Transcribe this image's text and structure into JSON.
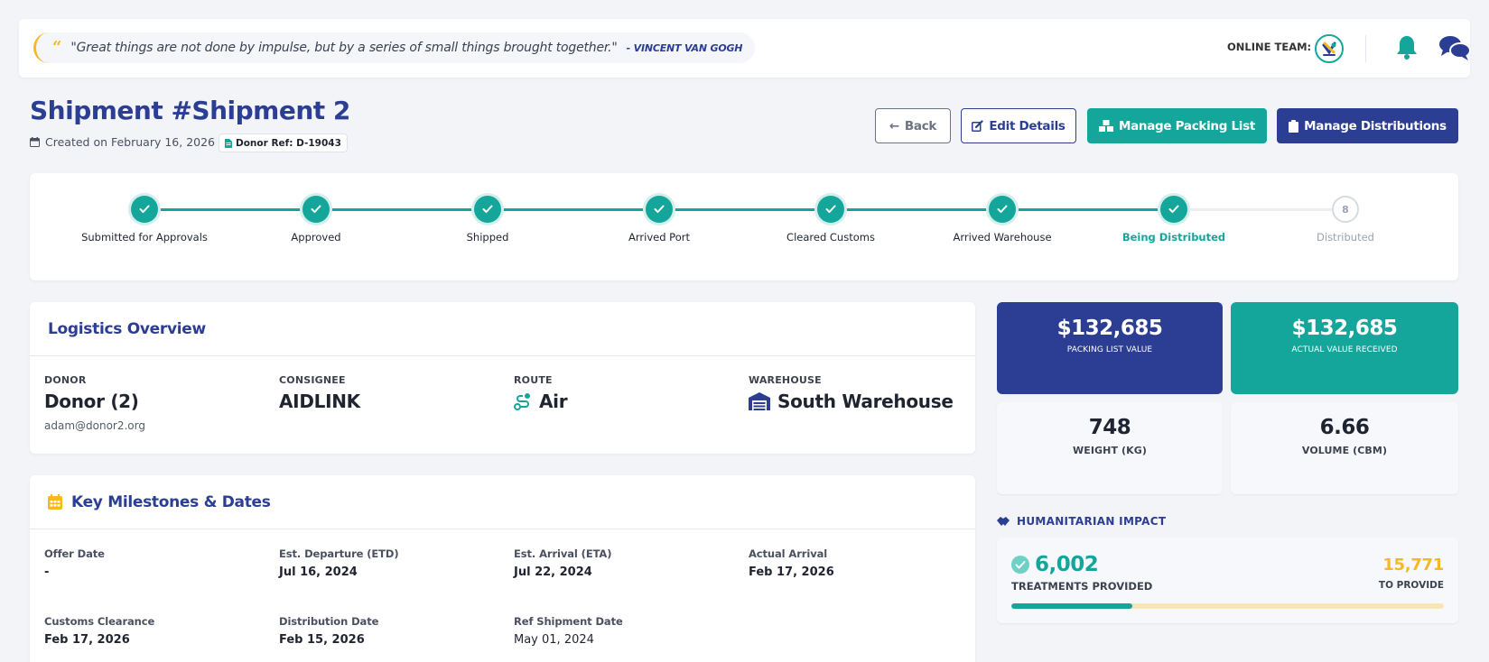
{
  "topbar": {
    "quote": "\"Great things are not done by impulse, but by a series of small things brought together.\"",
    "quote_author": "- VINCENT VAN GOGH",
    "online_label": "ONLINE TEAM:"
  },
  "header": {
    "title": "Shipment #Shipment 2",
    "created": "Created on February 16, 2026",
    "donor_ref": "Donor Ref: D-19043"
  },
  "actions": {
    "back": "Back",
    "edit": "Edit Details",
    "packing": "Manage Packing List",
    "distributions": "Manage Distributions"
  },
  "steps": [
    {
      "label": "Submitted for Approvals",
      "state": "done"
    },
    {
      "label": "Approved",
      "state": "done"
    },
    {
      "label": "Shipped",
      "state": "done"
    },
    {
      "label": "Arrived Port",
      "state": "done"
    },
    {
      "label": "Cleared Customs",
      "state": "done"
    },
    {
      "label": "Arrived Warehouse",
      "state": "done"
    },
    {
      "label": "Being Distributed",
      "state": "active"
    },
    {
      "label": "Distributed",
      "state": "pending",
      "number": "8"
    }
  ],
  "logistics": {
    "title": "Logistics Overview",
    "donor_label": "DONOR",
    "donor": "Donor (2)",
    "donor_email": "adam@donor2.org",
    "consignee_label": "CONSIGNEE",
    "consignee": "AIDLINK",
    "route_label": "ROUTE",
    "route": "Air",
    "warehouse_label": "WAREHOUSE",
    "warehouse": "South Warehouse"
  },
  "milestones": {
    "title": "Key Milestones & Dates",
    "offer_label": "Offer Date",
    "offer": "-",
    "etd_label": "Est. Departure (ETD)",
    "etd": "Jul 16, 2024",
    "eta_label": "Est. Arrival (ETA)",
    "eta": "Jul 22, 2024",
    "actual_label": "Actual Arrival",
    "actual": "Feb 17, 2026",
    "customs_label": "Customs Clearance",
    "customs": "Feb 17, 2026",
    "distribution_label": "Distribution Date",
    "distribution": "Feb 15, 2026",
    "ref_label": "Ref Shipment Date",
    "ref": "May 01, 2024"
  },
  "stats": {
    "packing_value": "$132,685",
    "packing_label": "PACKING LIST VALUE",
    "actual_value": "$132,685",
    "actual_label": "ACTUAL VALUE RECEIVED",
    "weight": "748",
    "weight_label": "WEIGHT (KG)",
    "volume": "6.66",
    "volume_label": "VOLUME (CBM)"
  },
  "impact": {
    "title": "HUMANITARIAN IMPACT",
    "provided": "6,002",
    "provided_label": "TREATMENTS PROVIDED",
    "to_provide": "15,771",
    "to_provide_label": "TO PROVIDE",
    "progress_fraction": 0.28
  },
  "colors": {
    "navy": "#2c3e94",
    "teal": "#14a69a",
    "gold": "#f5b921",
    "track_bg": "#f8e6b6"
  }
}
